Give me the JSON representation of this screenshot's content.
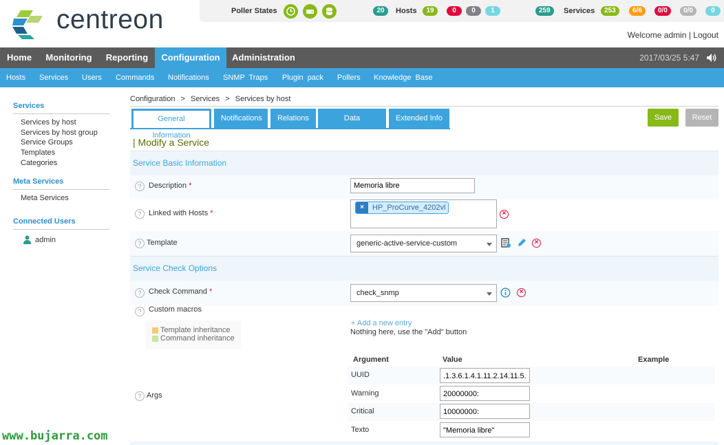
{
  "brand": {
    "name": "centreon"
  },
  "topbar": {
    "poller_states_label": "Poller States",
    "hosts": {
      "total": "20",
      "label": "Hosts",
      "up": "19",
      "down": "0",
      "unreachable": "0",
      "pending": "1"
    },
    "services": {
      "total": "259",
      "label": "Services",
      "ok": "253",
      "warning": "6/6",
      "critical": "0/0",
      "unknown": "0/0",
      "pending": "0"
    },
    "welcome_text": "Welcome admin",
    "separator": "|",
    "logout_label": "Logout"
  },
  "main_nav": {
    "items": [
      "Home",
      "Monitoring",
      "Reporting",
      "Configuration",
      "Administration"
    ],
    "active": "Configuration",
    "datetime": "2017/03/25 5:47"
  },
  "sub_nav": {
    "items": [
      "Hosts",
      "Services",
      "Users",
      "Commands",
      "Notifications",
      "SNMP  Traps",
      "Plugin  pack",
      "Pollers",
      "Knowledge  Base"
    ]
  },
  "sidebar": {
    "services_heading": "Services",
    "services_items": [
      "Services by host",
      "Services by host group",
      "Service Groups",
      "Templates",
      "Categories"
    ],
    "meta_heading": "Meta Services",
    "meta_items": [
      "Meta Services"
    ],
    "users_heading": "Connected Users",
    "users": [
      "admin"
    ]
  },
  "watermark": "www.bujarra.com",
  "breadcrumb": [
    "Configuration",
    ">",
    "Services",
    ">",
    "Services by host"
  ],
  "tabs": [
    "General Information",
    "Notifications",
    "Relations",
    "Data Processing",
    "Extended Info"
  ],
  "buttons": {
    "save": "Save",
    "reset": "Reset"
  },
  "form": {
    "title": "| Modify a Service",
    "section_basic": "Service Basic Information",
    "description_label": "Description",
    "description_value": "Memoria libre",
    "linked_hosts_label": "Linked with Hosts",
    "linked_host_value": "HP_ProCurve_4202vl",
    "template_label": "Template",
    "template_value": "generic-active-service-custom",
    "section_check": "Service Check Options",
    "check_command_label": "Check Command",
    "check_command_value": "check_snmp",
    "custom_macros_label": "Custom macros",
    "legend_template": "Template inheritance",
    "legend_command": "Command inheritance",
    "add_entry_label": "+ Add a new entry",
    "nothing_here_text": "Nothing here, use the \"Add\" button",
    "args_label": "Args",
    "args_headers": {
      "argument": "Argument",
      "value": "Value",
      "example": "Example"
    },
    "args": [
      {
        "name": "UUID",
        "value": ".1.3.6.1.4.1.11.2.14.11.5."
      },
      {
        "name": "Warning",
        "value": "20000000:"
      },
      {
        "name": "Critical",
        "value": "10000000:"
      },
      {
        "name": "Texto",
        "value": "\"Memoria libre\""
      }
    ],
    "required_mark": "*",
    "help_glyph": "?"
  },
  "colors": {
    "accent": "#3da3dd",
    "nav_bg": "#5b5b5b",
    "ok_green": "#88b917",
    "critical_red": "#e00b3d",
    "warning_orange": "#ff9a13"
  }
}
